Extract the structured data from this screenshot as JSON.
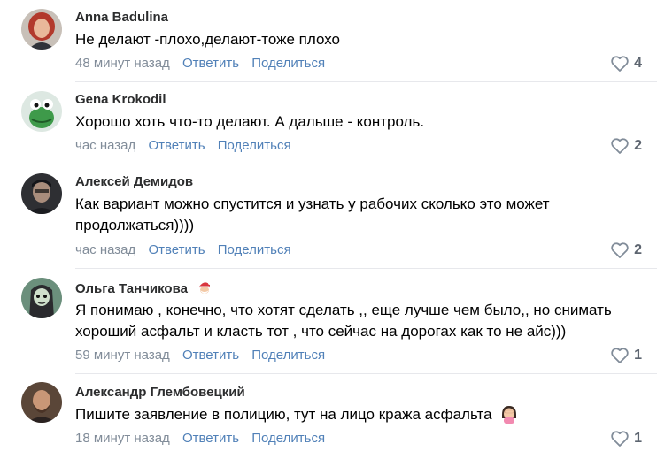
{
  "actions": {
    "reply": "Ответить",
    "share": "Поделиться"
  },
  "comments": [
    {
      "author": "Anna Badulina",
      "text": "Не делают -плохо,делают-тоже плохо",
      "time": "48 минут назад",
      "likes": "4",
      "avatar_icon": "user-photo-woman-red-hair"
    },
    {
      "author": "Gena Krokodil",
      "text": "Хорошо хоть что-то делают. А дальше - контроль.",
      "time": "час назад",
      "likes": "2",
      "avatar_icon": "crocodile-avatar"
    },
    {
      "author": "Алексей Демидов",
      "text": "Как вариант можно спустится и узнать у рабочих сколько это может продолжаться))))",
      "time": "час назад",
      "likes": "2",
      "avatar_icon": "user-photo-man-dark"
    },
    {
      "author": "Ольга Танчикова",
      "text": "Я понимаю , конечно, что хотят сделать ,, еще лучше чем было,, но снимать хороший асфальт и класть тот , что сейчас на дорогах как то не айс)))",
      "time": "59 минут назад",
      "likes": "1",
      "avatar_icon": "cartoon-girl-avatar",
      "badge_icon": "santa-emoji-icon"
    },
    {
      "author": "Александр Глембовецкий",
      "text": "Пишите заявление в полицию, тут на лицо кража асфальта",
      "time": "18 минут назад",
      "likes": "1",
      "avatar_icon": "user-photo-man-beard",
      "trailing_emoji": "facepalm-woman-emoji"
    }
  ],
  "colors": {
    "link": "#5181b8",
    "meta": "#818c99",
    "divider": "#e7e8ec"
  }
}
